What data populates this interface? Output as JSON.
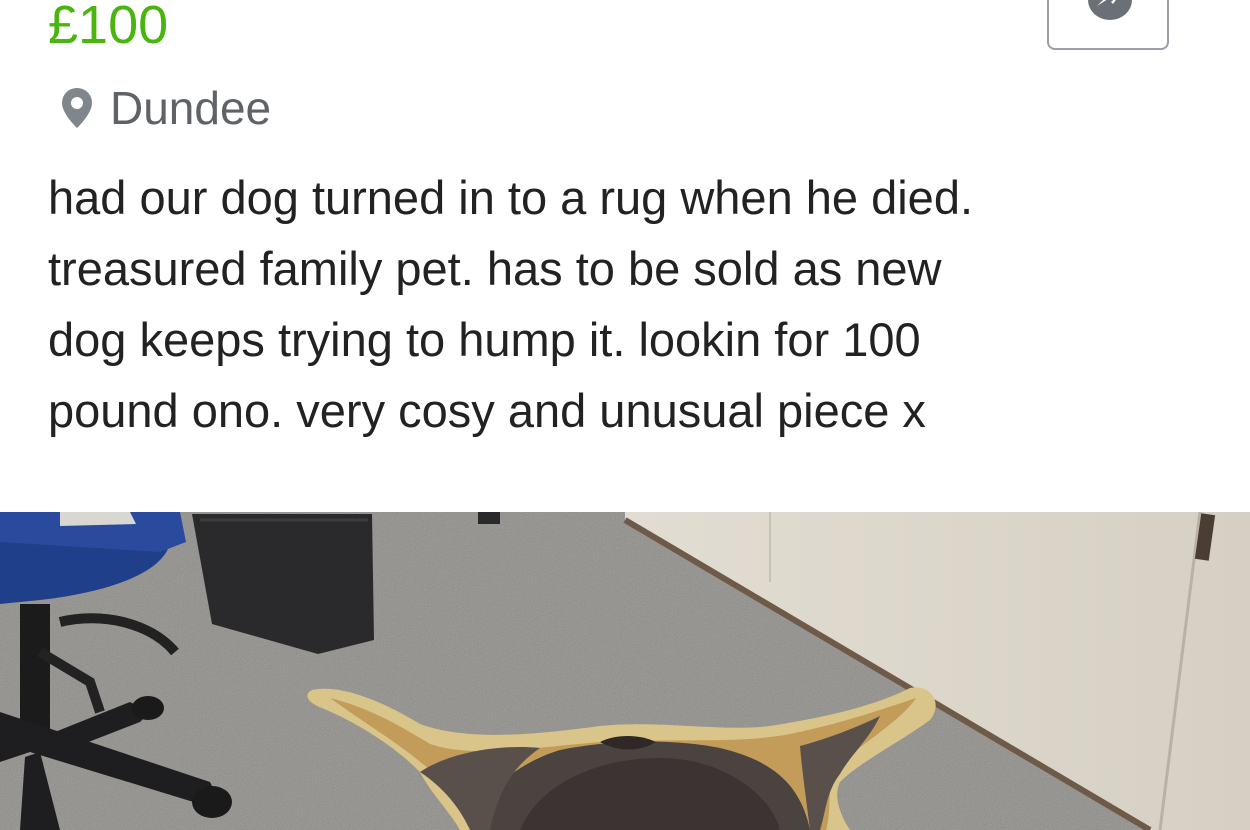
{
  "listing": {
    "price": "£100",
    "location": "Dundee",
    "description_lines": [
      "had our dog turned in to a rug when he died.",
      "treasured family pet. has to be sold as new",
      "dog keeps trying to hump it. lookin for 100",
      "pound ono. very cosy and unusual piece x"
    ]
  },
  "colors": {
    "price": "#4bb510",
    "location": "#5f6368",
    "description": "#222222",
    "button_border": "#9aa0a6"
  },
  "icons": {
    "location": "map-pin-icon",
    "message": "messenger-icon"
  },
  "photo": {
    "subject": "dog-skin rug on carpeted office floor"
  }
}
